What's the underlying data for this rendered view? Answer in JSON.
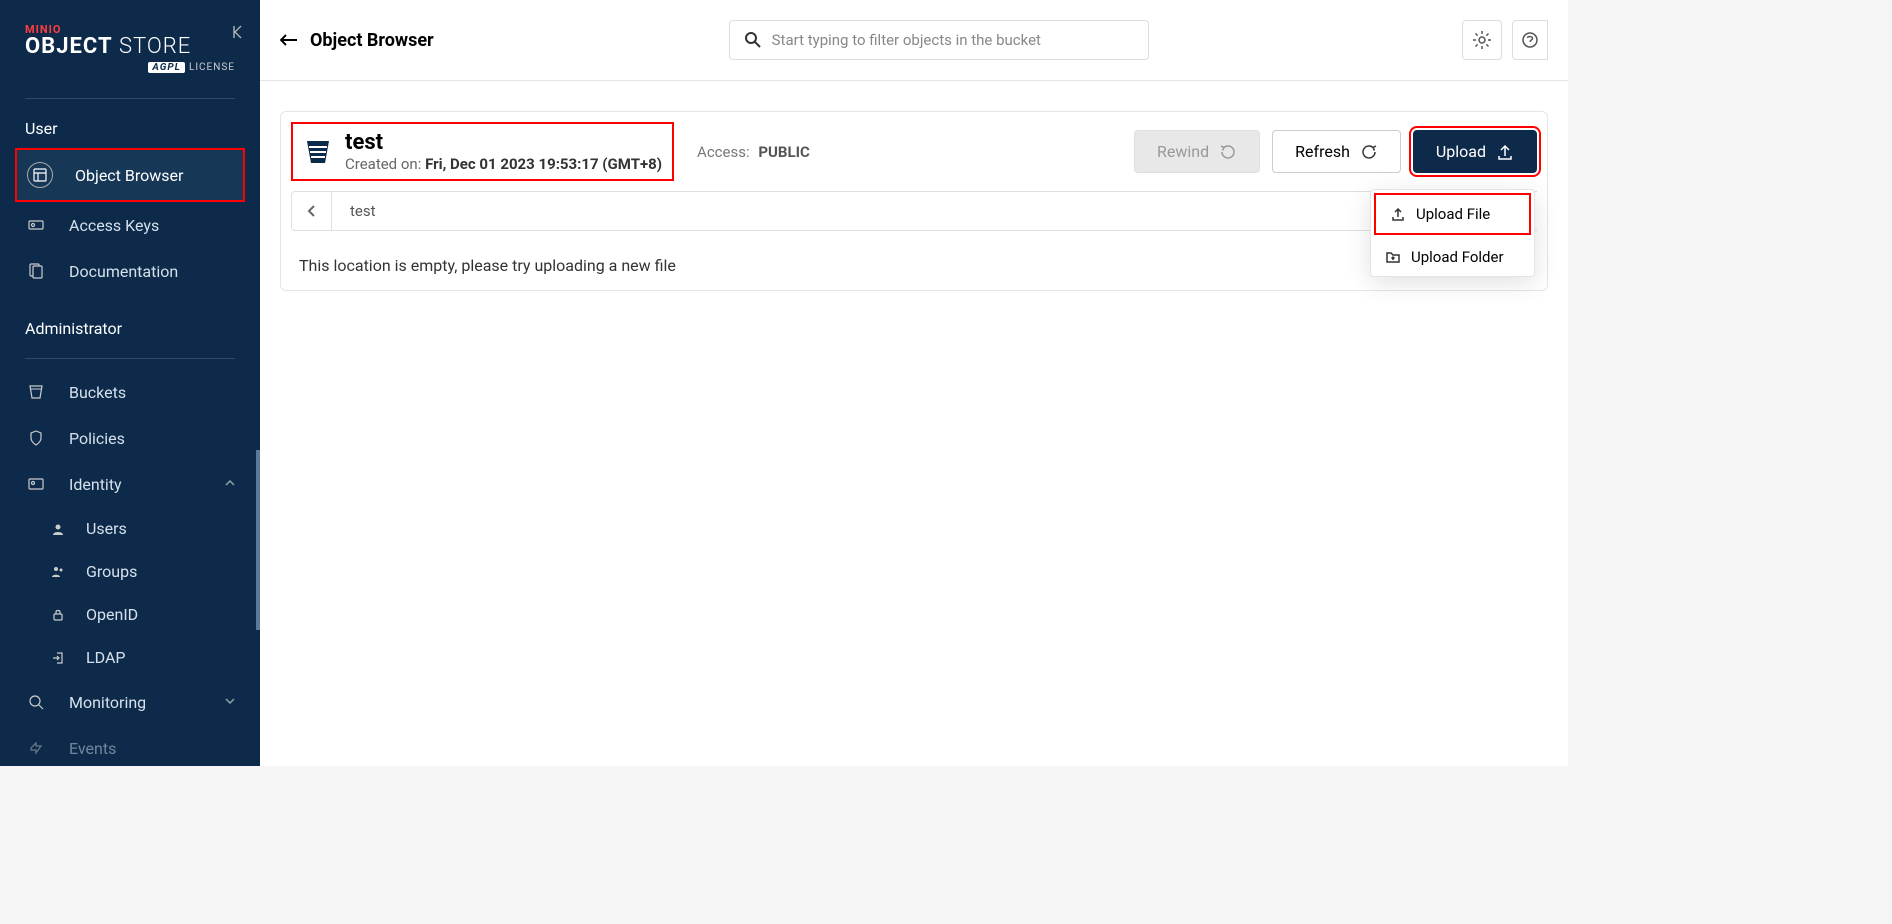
{
  "brand": {
    "minio": "MINIO",
    "object": "OBJECT",
    "store": "STORE",
    "agpl": "AGPL",
    "license": "LICENSE"
  },
  "sidebar": {
    "sections": {
      "user": "User",
      "admin": "Administrator"
    },
    "items": {
      "object_browser": "Object Browser",
      "access_keys": "Access Keys",
      "documentation": "Documentation",
      "buckets": "Buckets",
      "policies": "Policies",
      "identity": "Identity",
      "users": "Users",
      "groups": "Groups",
      "openid": "OpenID",
      "ldap": "LDAP",
      "monitoring": "Monitoring",
      "events": "Events"
    }
  },
  "header": {
    "title": "Object Browser",
    "search_placeholder": "Start typing to filter objects in the bucket"
  },
  "bucket": {
    "name": "test",
    "created_label": "Created on:",
    "created_value": "Fri, Dec 01 2023 19:53:17 (GMT+8)",
    "access_label": "Access:",
    "access_value": "PUBLIC",
    "path": "test"
  },
  "buttons": {
    "rewind": "Rewind",
    "refresh": "Refresh",
    "upload": "Upload",
    "upload_file": "Upload File",
    "upload_folder": "Upload Folder"
  },
  "empty": "This location is empty, please try uploading a new file"
}
